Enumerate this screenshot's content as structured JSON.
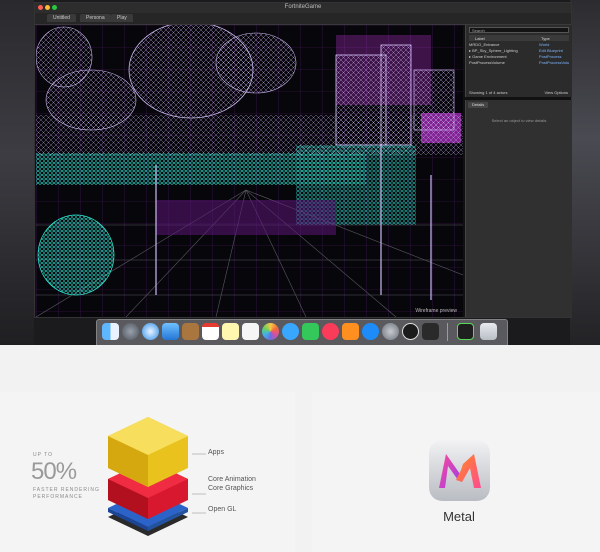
{
  "window": {
    "title": "FortniteGame",
    "tabs": [
      "Untitled",
      "Persona",
      "Play"
    ]
  },
  "viewport": {
    "caption": "Wireframe preview",
    "colors": {
      "wire_lavender": "#c9b8f0",
      "wire_cyan": "#29f0d8",
      "wire_magenta": "#e33cff",
      "background": "#07060a"
    }
  },
  "outliner": {
    "search_placeholder": "Search",
    "columns": {
      "label": "Label",
      "type": "Type"
    },
    "rows": [
      {
        "label": "MRDO_Entrance",
        "type": "World"
      },
      {
        "label": "▸ BP_Sky_Sphere_Lighting",
        "type": "Edit Blueprint"
      },
      {
        "label": "▸ Game Environment",
        "type": "PostProcess"
      },
      {
        "label": "PostProcessVolume",
        "type": "PostProcessVolume"
      }
    ],
    "footer_count": "Showing 1 of 4 actors",
    "view_options": "View Options"
  },
  "details": {
    "tab": "Details",
    "message": "Select an object to view details"
  },
  "dock": {
    "icons": [
      "finder-icon",
      "launchpad-icon",
      "safari-icon",
      "mail-icon",
      "contacts-icon",
      "calendar-icon",
      "notes-icon",
      "reminders-icon",
      "photos-icon",
      "messages-icon",
      "facetime-icon",
      "music-icon",
      "ibooks-icon",
      "app-store-icon",
      "system-preferences-icon",
      "unreal-engine-icon",
      "fortnite-icon",
      "activity-monitor-icon",
      "trash-icon"
    ]
  },
  "performance": {
    "up_to": "UP TO",
    "value": "50%",
    "description": "FASTER RENDERING PERFORMANCE"
  },
  "stack_layers": {
    "apps": "Apps",
    "core_animation": "Core Animation",
    "core_graphics": "Core Graphics",
    "open_gl": "Open GL",
    "colors": {
      "apps": "#e9c21e",
      "core": "#d8182e",
      "gl": "#2b63c9",
      "base": "#2a2a2a"
    }
  },
  "metal": {
    "label": "Metal",
    "icon_name": "metal-app-icon",
    "colors": {
      "pink": "#ff4a93",
      "orange": "#ff8a1e",
      "violet": "#9b3ef0"
    }
  }
}
